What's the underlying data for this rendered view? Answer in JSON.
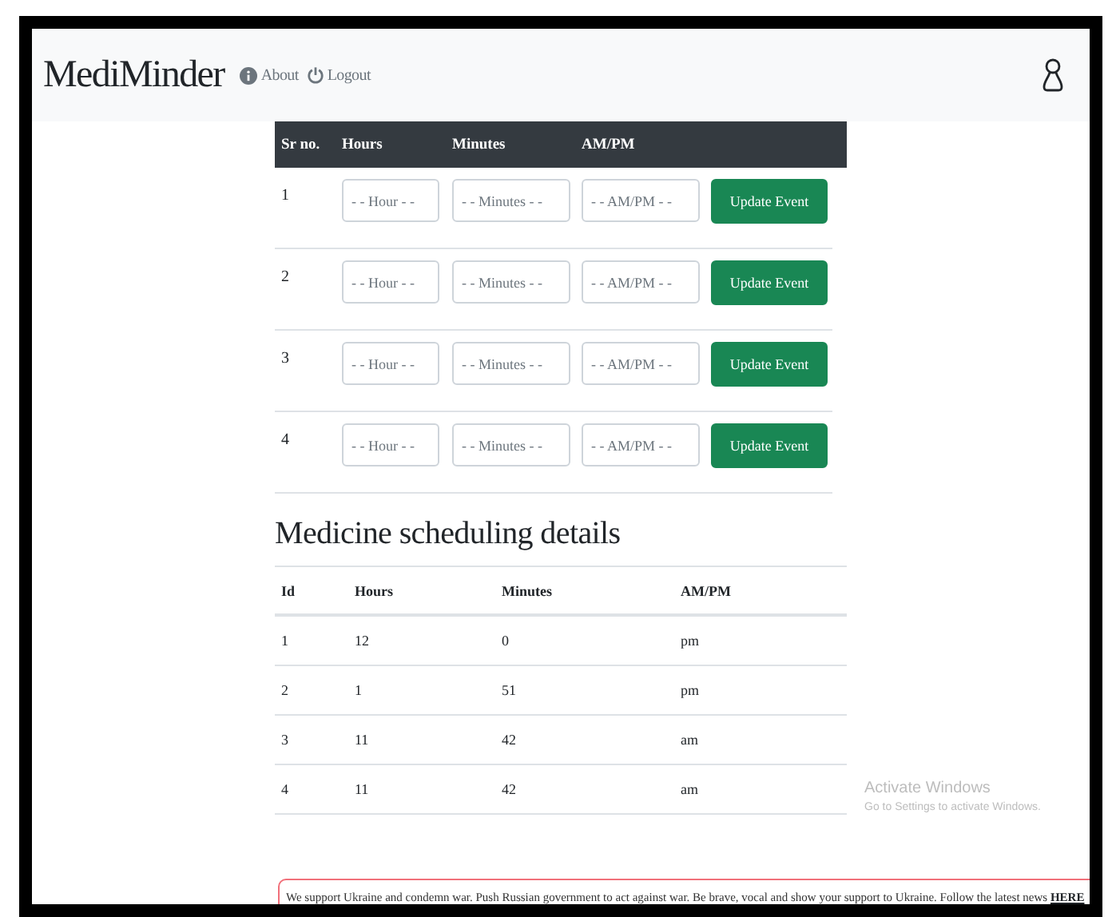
{
  "navbar": {
    "brand": "MediMinder",
    "links": [
      {
        "label": "About"
      },
      {
        "label": "Logout"
      }
    ]
  },
  "event_table": {
    "columns": [
      "Sr no.",
      "Hours",
      "Minutes",
      "AM/PM"
    ],
    "rows": [
      {
        "sr_no": "1",
        "hour_placeholder": "- - Hour - -",
        "minutes_placeholder": "- - Minutes - -",
        "ampm_placeholder": "- - AM/PM - -",
        "button": "Update Event"
      },
      {
        "sr_no": "2",
        "hour_placeholder": "- - Hour - -",
        "minutes_placeholder": "- - Minutes - -",
        "ampm_placeholder": "- - AM/PM - -",
        "button": "Update Event"
      },
      {
        "sr_no": "3",
        "hour_placeholder": "- - Hour - -",
        "minutes_placeholder": "- - Minutes - -",
        "ampm_placeholder": "- - AM/PM - -",
        "button": "Update Event"
      },
      {
        "sr_no": "4",
        "hour_placeholder": "- - Hour - -",
        "minutes_placeholder": "- - Minutes - -",
        "ampm_placeholder": "- - AM/PM - -",
        "button": "Update Event"
      }
    ]
  },
  "details": {
    "title": "Medicine scheduling details",
    "columns": [
      "Id",
      "Hours",
      "Minutes",
      "AM/PM"
    ],
    "rows": [
      [
        "1",
        "12",
        "0",
        "pm"
      ],
      [
        "2",
        "1",
        "51",
        "pm"
      ],
      [
        "3",
        "11",
        "42",
        "am"
      ],
      [
        "4",
        "11",
        "42",
        "am"
      ]
    ]
  },
  "banner": {
    "text": "We support Ukraine and condemn war. Push Russian government to act against war. Be brave, vocal and show your support to Ukraine. Follow the latest news",
    "link": "HERE"
  },
  "os_notice": {
    "title": "Activate Windows",
    "subtitle": "Go to Settings to activate Windows."
  }
}
